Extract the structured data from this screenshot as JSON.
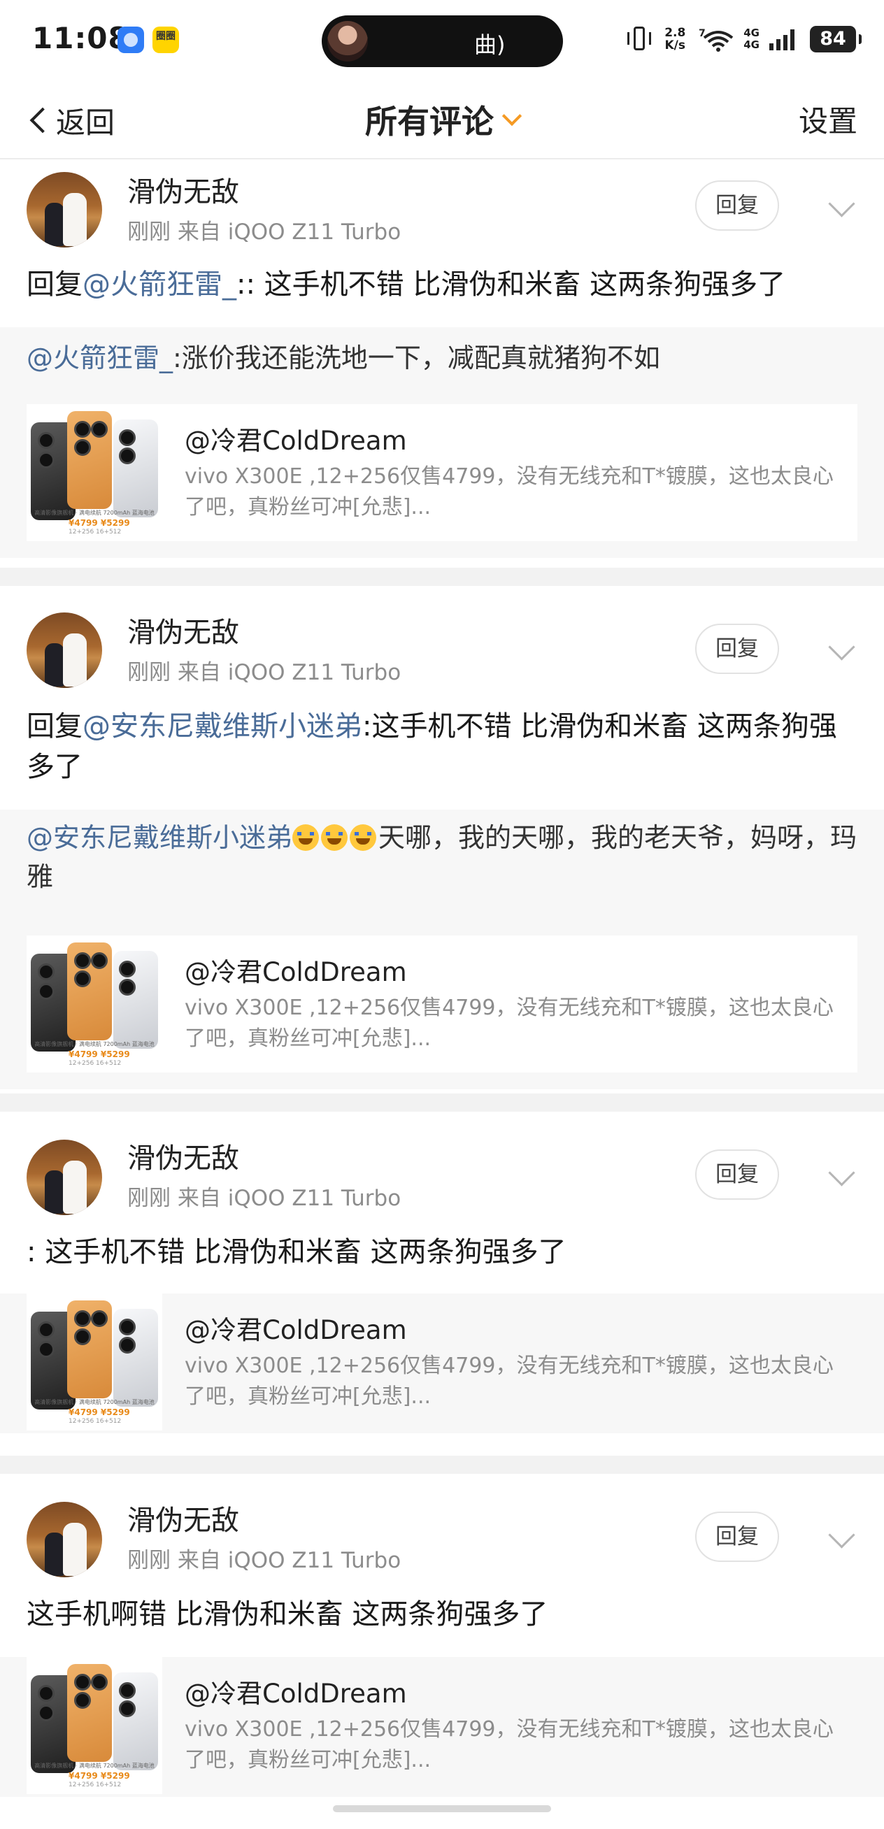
{
  "status_bar": {
    "time": "11:08",
    "app_badge": "圈圈",
    "media_text": "曲)",
    "net_speed_value": "2.8",
    "net_speed_unit": "K/s",
    "wifi_badge": "7",
    "signal_top": "4G",
    "signal_bottom": "4G",
    "battery": "84"
  },
  "nav": {
    "back_label": "返回",
    "title": "所有评论",
    "settings_label": "设置"
  },
  "card": {
    "title": "@冷君ColdDream",
    "desc": "vivo X300E ,12+256仅售4799，没有无线充和T*镀膜，这也太良心了吧，真粉丝可冲[允悲]...",
    "thumb_caption": "高清影像旗舰机 · 满电续航 7200mAh 蓝海电池",
    "thumb_price": "¥4799  ¥5299",
    "thumb_price2": "12+256  16+512"
  },
  "comments": [
    {
      "username": "滑伪无敌",
      "meta": "刚刚  来自 iQOO Z11 Turbo",
      "reply_label": "回复",
      "body_prefix": "回复",
      "body_mention": "@火箭狂雷_",
      "body_rest": ":: 这手机不错  比滑伪和米畜 这两条狗强多了",
      "quote_mention": "@火箭狂雷_",
      "quote_rest": ":涨价我还能洗地一下，减配真就猪狗不如"
    },
    {
      "username": "滑伪无敌",
      "meta": "刚刚  来自 iQOO Z11 Turbo",
      "reply_label": "回复",
      "body_prefix": "回复",
      "body_mention": "@安东尼戴维斯小迷弟",
      "body_rest": ":这手机不错  比滑伪和米畜 这两条狗强多了",
      "quote_mention": "@安东尼戴维斯小迷弟",
      "quote_rest": "天哪，我的天哪，我的老天爷，妈呀，玛雅"
    },
    {
      "username": "滑伪无敌",
      "meta": "刚刚  来自 iQOO Z11 Turbo",
      "reply_label": "回复",
      "body_text": ": 这手机不错  比滑伪和米畜 这两条狗强多了"
    },
    {
      "username": "滑伪无敌",
      "meta": "刚刚  来自 iQOO Z11 Turbo",
      "reply_label": "回复",
      "body_text": "这手机啊错  比滑伪和米畜 这两条狗强多了"
    }
  ]
}
